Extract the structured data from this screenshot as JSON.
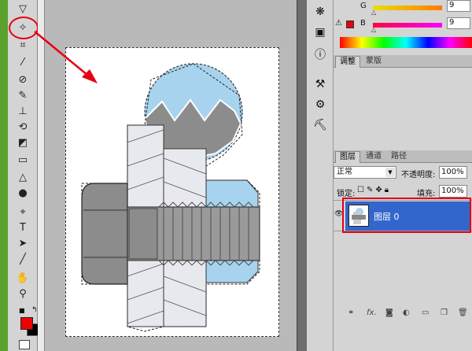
{
  "color_panel": {
    "g_label": "G",
    "g_value": "9",
    "b_label": "B",
    "b_value": "9",
    "accent_red": "#e60012"
  },
  "adjust_tabs": [
    {
      "label": "调整",
      "active": true
    },
    {
      "label": "蒙版",
      "active": false
    }
  ],
  "layers_tabs": [
    {
      "label": "图层",
      "active": true
    },
    {
      "label": "通道",
      "active": false
    },
    {
      "label": "路径",
      "active": false
    }
  ],
  "layers": {
    "blend_mode": "正常",
    "opacity_label": "不透明度:",
    "opacity_value": "100%",
    "lock_label": "锁定:",
    "fill_label": "填充:",
    "fill_value": "100%",
    "layer_name": "图层 0",
    "selection_color": "#3366cc"
  },
  "footer_icons": [
    "link-icon",
    "fx-icon",
    "mask-icon",
    "adjustment-icon",
    "group-icon",
    "new-layer-icon",
    "trash-icon"
  ],
  "tools": [
    "move-icon",
    "lasso-icon",
    "magic-wand-icon",
    "crop-icon",
    "eyedropper-icon",
    "healing-icon",
    "brush-icon",
    "stamp-icon",
    "history-brush-icon",
    "eraser-icon",
    "gradient-icon",
    "blur-icon",
    "dodge-icon",
    "pen-icon",
    "type-icon",
    "path-select-icon",
    "line-icon",
    "hand-icon",
    "zoom-icon"
  ],
  "colors": {
    "foreground": "#f20000",
    "background": "#000000"
  }
}
